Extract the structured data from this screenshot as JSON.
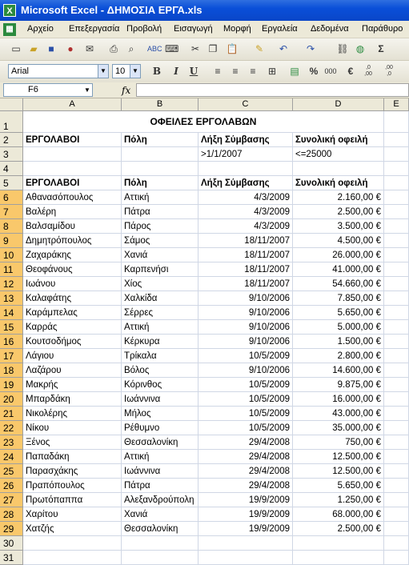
{
  "window": {
    "title": "Microsoft Excel - ΔΗΜΟΣΙΑ ΕΡΓΑ.xls",
    "app_icon": "excel-icon"
  },
  "menu": [
    "Αρχείο",
    "Επεξεργασία",
    "Προβολή",
    "Εισαγωγή",
    "Μορφή",
    "Εργαλεία",
    "Δεδομένα",
    "Παράθυρο"
  ],
  "standard_toolbar": [
    "new-icon",
    "open-icon",
    "save-icon",
    "permission-icon",
    "email-icon",
    "print-icon",
    "print-preview-icon",
    "spelling-icon",
    "research-icon",
    "cut-icon",
    "copy-icon",
    "paste-icon",
    "format-painter-icon",
    "undo-icon",
    "redo-icon",
    "hyperlink-icon",
    "web-icon",
    "autosum-icon"
  ],
  "formatting": {
    "font": "Arial",
    "size": "10",
    "bold": "B",
    "italic": "I",
    "underline": "U",
    "percent": "%",
    "thousands": "000",
    "currency": "€",
    "inc_decimal": ",0 ,00",
    "dec_decimal": ",00 ,0"
  },
  "formula_bar": {
    "name_box": "F6",
    "fx": "fx",
    "content": ""
  },
  "columns": [
    "A",
    "B",
    "C",
    "D",
    "E"
  ],
  "row_numbers": [
    "1",
    "2",
    "3",
    "4",
    "5",
    "6",
    "7",
    "8",
    "9",
    "10",
    "11",
    "12",
    "13",
    "14",
    "15",
    "16",
    "17",
    "18",
    "19",
    "20",
    "21",
    "22",
    "23",
    "24",
    "25",
    "26",
    "27",
    "28",
    "29",
    "30",
    "31"
  ],
  "sheet": {
    "title": "ΟΦΕΙΛΕΣ ΕΡΓΟΛΑΒΩΝ",
    "criteria_header": [
      "ΕΡΓΟΛΑΒΟΙ",
      "Πόλη",
      "Λήξη Σύμβασης",
      "Συνολική οφειλή"
    ],
    "criteria_values": [
      "",
      "",
      ">1/1/2007",
      "<=25000"
    ],
    "table_header": [
      "ΕΡΓΟΛΑΒΟΙ",
      "Πόλη",
      "Λήξη Σύμβασης",
      "Συνολική οφειλή"
    ],
    "rows": [
      [
        "Αθανασόπουλος",
        "Αττική",
        "4/3/2009",
        "2.160,00 €"
      ],
      [
        "Βαλέρη",
        "Πάτρα",
        "4/3/2009",
        "2.500,00 €"
      ],
      [
        "Βαλσαμίδου",
        "Πάρος",
        "4/3/2009",
        "3.500,00 €"
      ],
      [
        "Δημητρόπουλος",
        "Σάμος",
        "18/11/2007",
        "4.500,00 €"
      ],
      [
        "Ζαχαράκης",
        "Χανιά",
        "18/11/2007",
        "26.000,00 €"
      ],
      [
        "Θεοφάνους",
        "Καρπενήσι",
        "18/11/2007",
        "41.000,00 €"
      ],
      [
        "Ιωάνου",
        "Χίος",
        "18/11/2007",
        "54.660,00 €"
      ],
      [
        "Καλαφάτης",
        "Χαλκίδα",
        "9/10/2006",
        "7.850,00 €"
      ],
      [
        "Καράμπελας",
        "Σέρρες",
        "9/10/2006",
        "5.650,00 €"
      ],
      [
        "Καρράς",
        "Αττική",
        "9/10/2006",
        "5.000,00 €"
      ],
      [
        "Κουτσοδήμος",
        "Κέρκυρα",
        "9/10/2006",
        "1.500,00 €"
      ],
      [
        "Λάγιου",
        "Τρίκαλα",
        "10/5/2009",
        "2.800,00 €"
      ],
      [
        "Λαζάρου",
        "Βόλος",
        "9/10/2006",
        "14.600,00 €"
      ],
      [
        "Μακρής",
        "Κόρινθος",
        "10/5/2009",
        "9.875,00 €"
      ],
      [
        "Μπαρδάκη",
        "Ιωάννινα",
        "10/5/2009",
        "16.000,00 €"
      ],
      [
        "Νικολέρης",
        "Μήλος",
        "10/5/2009",
        "43.000,00 €"
      ],
      [
        "Νίκου",
        "Ρέθυμνο",
        "10/5/2009",
        "35.000,00 €"
      ],
      [
        "Ξένος",
        "Θεσσαλονίκη",
        "29/4/2008",
        "750,00 €"
      ],
      [
        "Παπαδάκη",
        "Αττική",
        "29/4/2008",
        "12.500,00 €"
      ],
      [
        "Παρασχάκης",
        "Ιωάννινα",
        "29/4/2008",
        "12.500,00 €"
      ],
      [
        "Πραπόπουλος",
        "Πάτρα",
        "29/4/2008",
        "5.650,00 €"
      ],
      [
        "Πρωτόπαππα",
        "Αλεξανδρούπολη",
        "19/9/2009",
        "1.250,00 €"
      ],
      [
        "Χαρίτου",
        "Χανιά",
        "19/9/2009",
        "68.000,00 €"
      ],
      [
        "Χατζής",
        "Θεσσαλονίκη",
        "19/9/2009",
        "2.500,00 €"
      ]
    ]
  },
  "colors": {
    "titlebar": "#0a4fd8",
    "chrome": "#ece9d8",
    "selected_row_header": "#f9c86b",
    "gridline": "#d0d7e5"
  }
}
